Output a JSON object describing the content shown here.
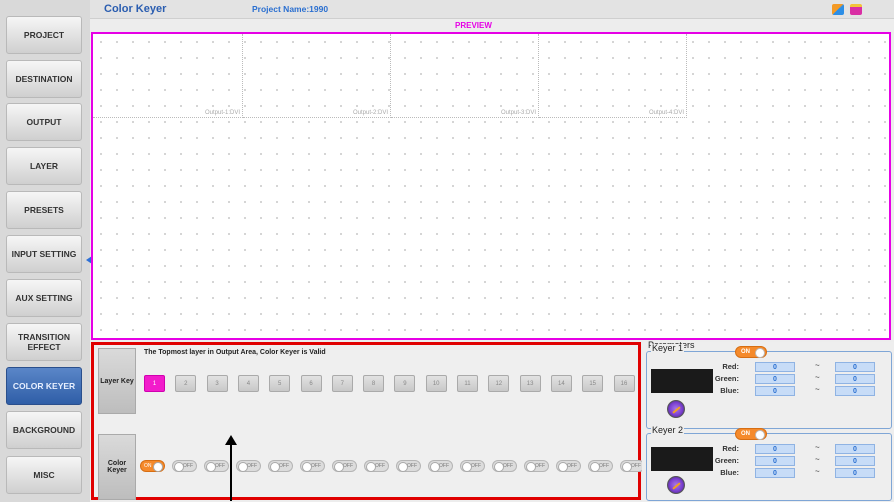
{
  "app": {
    "title": "Color Keyer",
    "project": "Project Name:1990",
    "preview_label": "PREVIEW"
  },
  "sidebar": {
    "items": [
      {
        "label": "PROJECT"
      },
      {
        "label": "DESTINATION"
      },
      {
        "label": "OUTPUT"
      },
      {
        "label": "LAYER"
      },
      {
        "label": "PRESETS"
      },
      {
        "label": "INPUT SETTING"
      },
      {
        "label": "AUX SETTING"
      },
      {
        "label": "TRANSITION EFFECT"
      },
      {
        "label": "COLOR KEYER",
        "active": true
      },
      {
        "label": "BACKGROUND"
      },
      {
        "label": "MISC"
      }
    ]
  },
  "preview": {
    "outputs": [
      "Output-1:DVI",
      "Output-2:DVI",
      "Output-3:DVI",
      "Output-4:DVI"
    ]
  },
  "keypanel": {
    "notice": "The Topmost layer in Output Area, Color Keyer is Valid",
    "layer_key_label": "Layer Key",
    "color_keyer_label": "Color Keyer",
    "layer_keys": [
      "1",
      "2",
      "3",
      "4",
      "5",
      "6",
      "7",
      "8",
      "9",
      "10",
      "11",
      "12",
      "13",
      "14",
      "15",
      "16"
    ],
    "selected_key": "1",
    "toggles": [
      "ON",
      "OFF",
      "OFF",
      "OFF",
      "OFF",
      "OFF",
      "OFF",
      "OFF",
      "OFF",
      "OFF",
      "OFF",
      "OFF",
      "OFF",
      "OFF",
      "OFF",
      "OFF"
    ]
  },
  "parameters": {
    "title": "Parameters",
    "keyer1": {
      "title": "Keyer 1",
      "state": "ON",
      "red_label": "Red:",
      "green_label": "Green:",
      "blue_label": "Blue:",
      "red_min": "0",
      "red_max": "0",
      "green_min": "0",
      "green_max": "0",
      "blue_min": "0",
      "blue_max": "0",
      "sep": "~"
    },
    "keyer2": {
      "title": "Keyer 2",
      "state": "ON",
      "red_label": "Red:",
      "green_label": "Green:",
      "blue_label": "Blue:",
      "red_min": "0",
      "red_max": "0",
      "green_min": "0",
      "green_max": "0",
      "blue_min": "0",
      "blue_max": "0",
      "sep": "~"
    }
  },
  "colors": {
    "accent": "#2a5db0",
    "preview_border": "#e600e6",
    "selected_key": "#f21ccb",
    "panel_border": "#e00000",
    "toggle_on": "#f58a2b"
  }
}
